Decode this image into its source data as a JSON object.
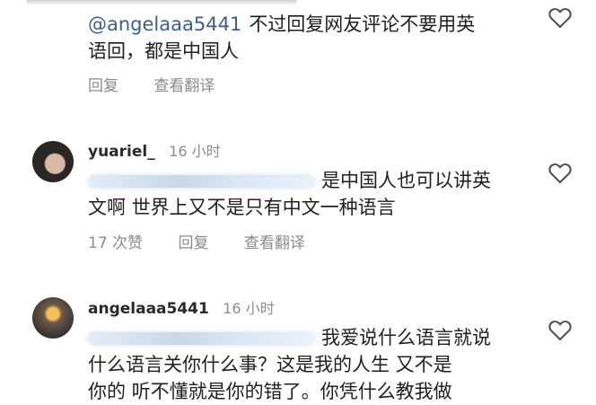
{
  "comments": [
    {
      "mention": "@angelaaa5441",
      "text_line1": "不过回复网友评论不要用英",
      "text_line2": "语回，都是中国人",
      "actions": {
        "reply": "回复",
        "translate": "查看翻译"
      }
    },
    {
      "username": "yuariel_",
      "time": "16 小时",
      "text_line1": "是中国人也可以讲英",
      "text_line2": "文啊 世界上又不是只有中文一种语言",
      "actions": {
        "likes": "17 次赞",
        "reply": "回复",
        "translate": "查看翻译"
      }
    },
    {
      "username": "angelaaa5441",
      "time": "16 小时",
      "text_line1": "我爱说什么语言就说",
      "text_line2": "什么语言关你什么事？这是我的人生 又不是",
      "text_line3": "你的 听不懂就是你的错了。你凭什么教我做"
    }
  ],
  "icons": {
    "like": "heart-outline-icon"
  }
}
